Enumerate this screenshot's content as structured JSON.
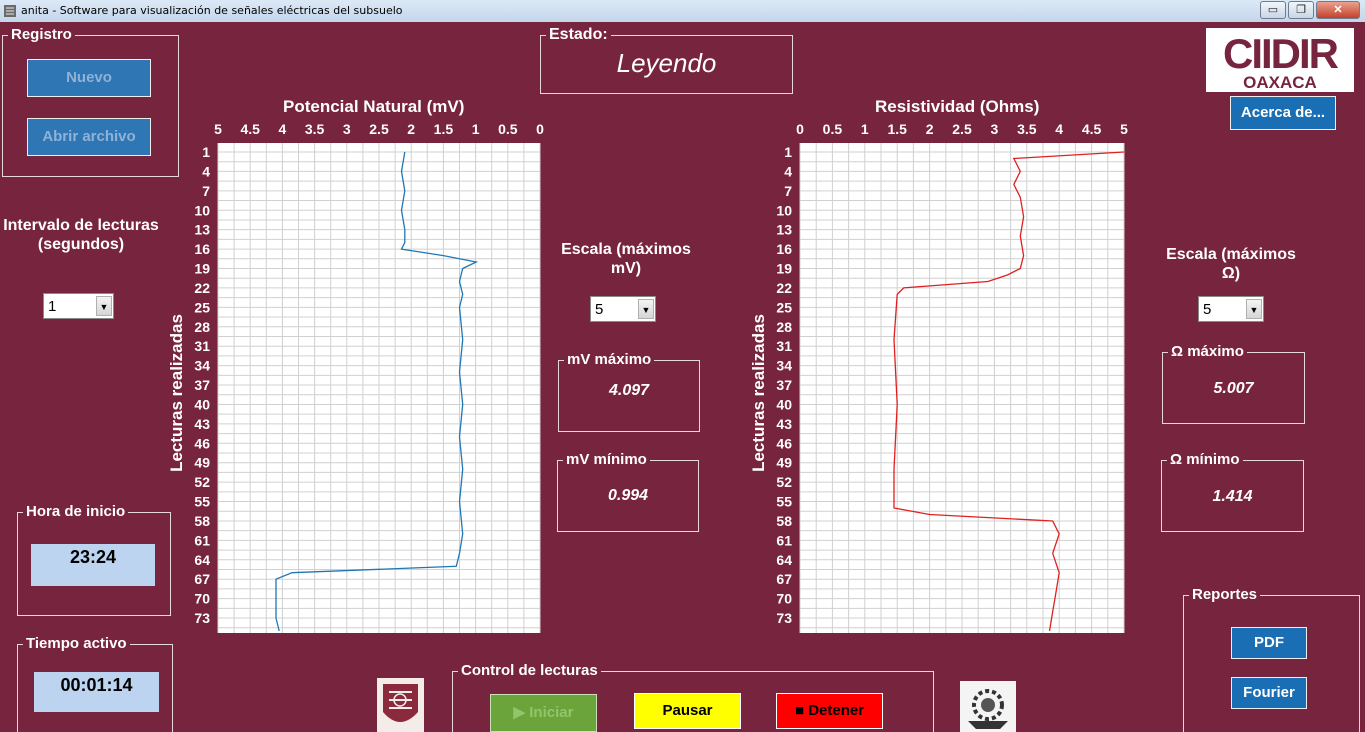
{
  "window": {
    "title": "anita - Software para visualización de señales eléctricas del subsuelo",
    "minimize_glyph": "▭",
    "restore_glyph": "❐",
    "close_glyph": "✕"
  },
  "registro": {
    "label": "Registro",
    "nuevo_label": "Nuevo",
    "abrir_label": "Abrir archivo"
  },
  "intervalo": {
    "label": "Intervalo de lecturas (segundos)",
    "value": "1"
  },
  "hora_inicio": {
    "label": "Hora de inicio",
    "value": "23:24"
  },
  "tiempo_activo": {
    "label": "Tiempo activo",
    "value": "00:01:14"
  },
  "estado": {
    "label": "Estado:",
    "value": "Leyendo"
  },
  "escala_mv": {
    "label": "Escala (máximos mV)",
    "value": "5"
  },
  "mv_max": {
    "label": "mV máximo",
    "value": "4.097"
  },
  "mv_min": {
    "label": "mV mínimo",
    "value": "0.994"
  },
  "escala_ohm": {
    "label": "Escala (máximos Ω)",
    "value": "5"
  },
  "ohm_max": {
    "label": "Ω máximo",
    "value": "5.007"
  },
  "ohm_min": {
    "label": "Ω mínimo",
    "value": "1.414"
  },
  "logo": {
    "line1": "CIIDIR",
    "line2": "OAXACA"
  },
  "acerca_label": "Acerca de...",
  "reportes": {
    "label": "Reportes",
    "pdf_label": "PDF",
    "fourier_label": "Fourier"
  },
  "control": {
    "label": "Control de lecturas",
    "iniciar_label": "Iniciar",
    "iniciar_icon": "▶",
    "pausar_label": "Pausar",
    "detener_label": "Detener",
    "detener_icon": "■"
  },
  "colors": {
    "background": "#77243f",
    "line_pn": "#1f77b4",
    "line_res": "#e02020",
    "time_box": "#bcd4ef",
    "pausar": "#ffff00",
    "detener": "#ff0000",
    "iniciar_disabled": "#6aa43a"
  },
  "chart_data": [
    {
      "type": "line",
      "title": "Potencial Natural (mV)",
      "xlabel": "",
      "ylabel": "Lecturas realizadas",
      "x_reversed": true,
      "xlim": [
        0,
        5
      ],
      "x_ticks": [
        "5",
        "4.5",
        "4",
        "3.5",
        "3",
        "2.5",
        "2",
        "1.5",
        "1",
        "0.5",
        "0"
      ],
      "y_ticks": [
        "1",
        "4",
        "7",
        "10",
        "13",
        "16",
        "19",
        "22",
        "25",
        "28",
        "31",
        "34",
        "37",
        "40",
        "43",
        "46",
        "49",
        "52",
        "55",
        "58",
        "61",
        "64",
        "67",
        "70",
        "73"
      ],
      "ylim": [
        1,
        75
      ],
      "grid": true,
      "color": "#1f77b4",
      "points": [
        [
          1,
          2.1
        ],
        [
          4,
          2.15
        ],
        [
          7,
          2.1
        ],
        [
          10,
          2.15
        ],
        [
          13,
          2.1
        ],
        [
          15,
          2.1
        ],
        [
          16,
          2.15
        ],
        [
          17,
          1.5
        ],
        [
          18,
          0.99
        ],
        [
          19,
          1.2
        ],
        [
          21,
          1.25
        ],
        [
          23,
          1.2
        ],
        [
          25,
          1.25
        ],
        [
          30,
          1.2
        ],
        [
          35,
          1.25
        ],
        [
          40,
          1.2
        ],
        [
          45,
          1.25
        ],
        [
          50,
          1.2
        ],
        [
          55,
          1.25
        ],
        [
          60,
          1.2
        ],
        [
          63,
          1.25
        ],
        [
          65,
          1.3
        ],
        [
          66,
          3.85
        ],
        [
          67,
          4.1
        ],
        [
          70,
          4.1
        ],
        [
          73,
          4.1
        ],
        [
          75,
          4.05
        ]
      ]
    },
    {
      "type": "line",
      "title": "Resistividad (Ohms)",
      "xlabel": "",
      "ylabel": "Lecturas realizadas",
      "x_reversed": false,
      "xlim": [
        0,
        5
      ],
      "x_ticks": [
        "0",
        "0.5",
        "1",
        "1.5",
        "2",
        "2.5",
        "3",
        "3.5",
        "4",
        "4.5",
        "5"
      ],
      "y_ticks": [
        "1",
        "4",
        "7",
        "10",
        "13",
        "16",
        "19",
        "22",
        "25",
        "28",
        "31",
        "34",
        "37",
        "40",
        "43",
        "46",
        "49",
        "52",
        "55",
        "58",
        "61",
        "64",
        "67",
        "70",
        "73"
      ],
      "ylim": [
        1,
        75
      ],
      "grid": true,
      "color": "#e02020",
      "points": [
        [
          1,
          5.0
        ],
        [
          2,
          3.3
        ],
        [
          4,
          3.4
        ],
        [
          6,
          3.3
        ],
        [
          8,
          3.4
        ],
        [
          11,
          3.45
        ],
        [
          14,
          3.4
        ],
        [
          17,
          3.45
        ],
        [
          19,
          3.4
        ],
        [
          20,
          3.2
        ],
        [
          21,
          2.9
        ],
        [
          22,
          1.6
        ],
        [
          23,
          1.5
        ],
        [
          30,
          1.45
        ],
        [
          40,
          1.5
        ],
        [
          50,
          1.45
        ],
        [
          56,
          1.45
        ],
        [
          57,
          2.0
        ],
        [
          58,
          3.9
        ],
        [
          60,
          4.0
        ],
        [
          63,
          3.9
        ],
        [
          66,
          4.0
        ],
        [
          69,
          3.95
        ],
        [
          72,
          3.9
        ],
        [
          75,
          3.85
        ]
      ]
    }
  ]
}
